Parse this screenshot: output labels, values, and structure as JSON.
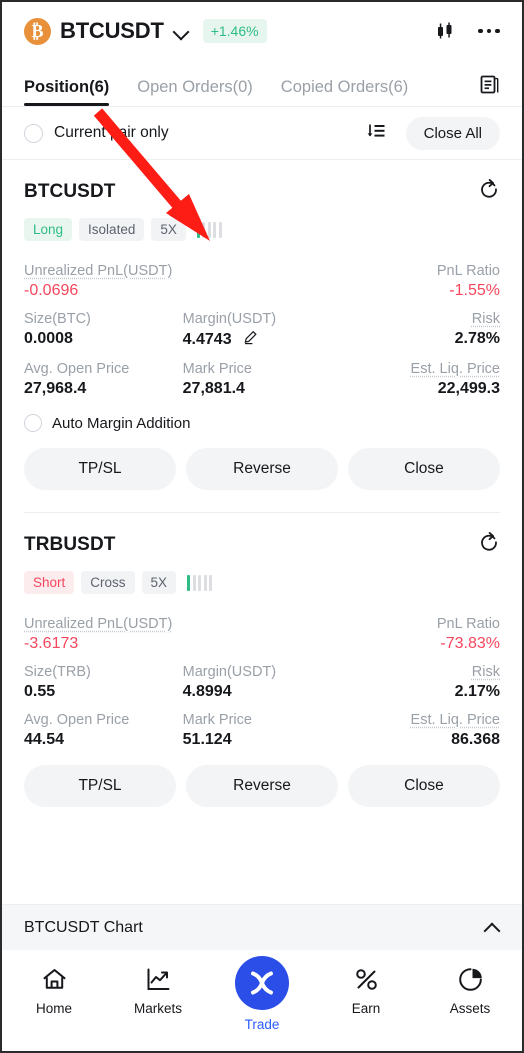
{
  "header": {
    "coin_symbol": "₿",
    "pair": "BTCUSDT",
    "change_pct": "+1.46%",
    "change_color": "#2ebd85",
    "chevron_icon": "chevron-down-icon",
    "candlestick_icon": "candlestick-chart-icon",
    "more_icon": "more-dots-icon"
  },
  "tabs": {
    "items": [
      {
        "label": "Position(6)",
        "active": true
      },
      {
        "label": "Open Orders(0)",
        "active": false
      },
      {
        "label": "Copied Orders(6)",
        "active": false
      }
    ],
    "order_history_icon": "document-icon"
  },
  "filter": {
    "current_pair_only": "Current pair only",
    "checked": false,
    "sort_icon": "sort-descending-icon",
    "close_all_label": "Close All"
  },
  "positions": [
    {
      "symbol": "BTCUSDT",
      "share_icon": "share-rotate-icon",
      "side": "Long",
      "side_type": "long",
      "margin_mode": "Isolated",
      "leverage": "5X",
      "lev_bars_total": 5,
      "lev_bars_on": 1,
      "pnl_label": "Unrealized PnL(USDT)",
      "pnl_value": "-0.0696",
      "pnl_ratio_label": "PnL Ratio",
      "pnl_ratio_value": "-1.55%",
      "size_label": "Size(BTC)",
      "size_value": "0.0008",
      "margin_label": "Margin(USDT)",
      "margin_value": "4.4743",
      "margin_editable": true,
      "risk_label": "Risk",
      "risk_value": "2.78%",
      "avg_open_label": "Avg. Open Price",
      "avg_open_value": "27,968.4",
      "mark_price_label": "Mark Price",
      "mark_price_value": "27,881.4",
      "liq_price_label": "Est. Liq. Price",
      "liq_price_value": "22,499.3",
      "auto_margin_label": "Auto Margin Addition",
      "auto_margin_checked": false,
      "show_auto_margin": true,
      "buttons": [
        "TP/SL",
        "Reverse",
        "Close"
      ]
    },
    {
      "symbol": "TRBUSDT",
      "share_icon": "share-rotate-icon",
      "side": "Short",
      "side_type": "short",
      "margin_mode": "Cross",
      "leverage": "5X",
      "lev_bars_total": 5,
      "lev_bars_on": 1,
      "pnl_label": "Unrealized PnL(USDT)",
      "pnl_value": "-3.6173",
      "pnl_ratio_label": "PnL Ratio",
      "pnl_ratio_value": "-73.83%",
      "size_label": "Size(TRB)",
      "size_value": "0.55",
      "margin_label": "Margin(USDT)",
      "margin_value": "4.8994",
      "margin_editable": false,
      "risk_label": "Risk",
      "risk_value": "2.17%",
      "avg_open_label": "Avg. Open Price",
      "avg_open_value": "44.54",
      "mark_price_label": "Mark Price",
      "mark_price_value": "51.124",
      "liq_price_label": "Est. Liq. Price",
      "liq_price_value": "86.368",
      "auto_margin_label": "",
      "auto_margin_checked": false,
      "show_auto_margin": false,
      "buttons": [
        "TP/SL",
        "Reverse",
        "Close"
      ]
    }
  ],
  "chart_strip": {
    "title": "BTCUSDT Chart",
    "collapse_icon": "chevron-up-icon"
  },
  "bottom_nav": {
    "items": [
      {
        "label": "Home",
        "icon": "home-icon",
        "active": false
      },
      {
        "label": "Markets",
        "icon": "trending-up-chart-icon",
        "active": false
      },
      {
        "label": "Trade",
        "icon": "trade-swap-icon",
        "active": true
      },
      {
        "label": "Earn",
        "icon": "percent-icon",
        "active": false
      },
      {
        "label": "Assets",
        "icon": "pie-chart-icon",
        "active": false
      }
    ],
    "accent_color": "#2b4ee8"
  },
  "annotation": {
    "arrow_color": "#fe1d14",
    "arrow_description": "red-arrow-pointing-to-position-tab"
  }
}
